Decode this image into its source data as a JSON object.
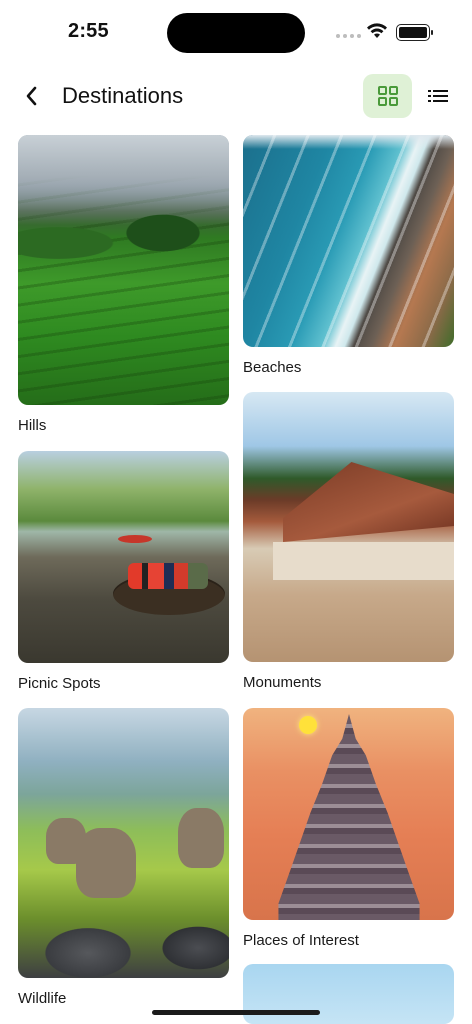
{
  "status_bar": {
    "time": "2:55"
  },
  "header": {
    "title": "Destinations"
  },
  "accent_color": "#dff1d6",
  "icons": {
    "back": "chevron-left-icon",
    "grid_view": "grid-icon",
    "list_view": "list-icon",
    "wifi": "wifi-icon",
    "battery": "battery-icon"
  },
  "destinations": [
    {
      "label": "Hills"
    },
    {
      "label": "Beaches"
    },
    {
      "label": "Picnic Spots"
    },
    {
      "label": "Monuments"
    },
    {
      "label": "Wildlife"
    },
    {
      "label": "Places of Interest"
    }
  ]
}
